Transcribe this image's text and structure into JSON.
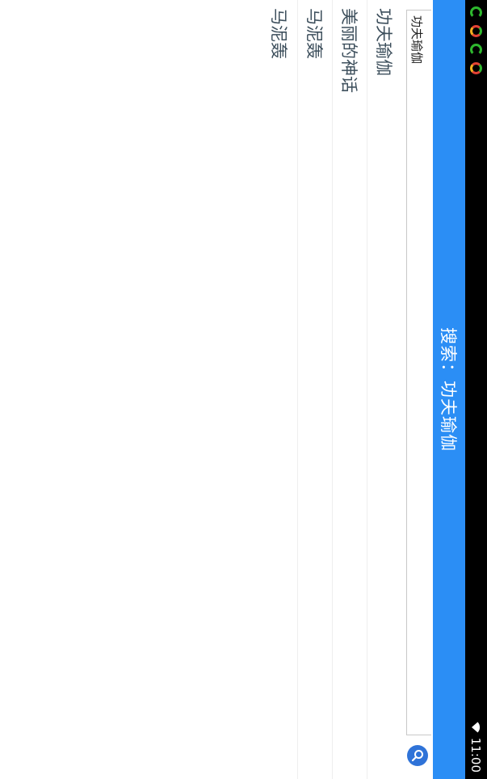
{
  "status_bar": {
    "time": "11:00",
    "icons": [
      "e-browser-icon",
      "o-app-icon",
      "e-browser-icon",
      "o-app-icon"
    ],
    "wifi_icon": "wifi-icon"
  },
  "header": {
    "title": "搜索：功夫瑜伽",
    "background_color": "#2b8ef5"
  },
  "search": {
    "value": "功夫瑜伽",
    "button_icon": "search-icon",
    "button_color": "#2f73d8"
  },
  "results": [
    {
      "label": "功夫瑜伽"
    },
    {
      "label": "美丽的神话"
    },
    {
      "label": "马泥轰"
    },
    {
      "label": "马泥轰"
    }
  ]
}
